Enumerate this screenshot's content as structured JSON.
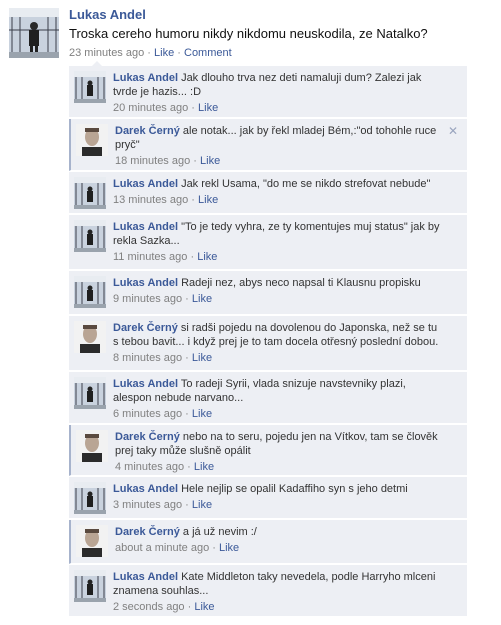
{
  "post": {
    "author": "Lukas Andel",
    "text": "Troska cereho humoru nikdy nikdomu neuskodila, ze Natalko?",
    "time": "23 minutes ago",
    "separator": "·",
    "like": "Like",
    "comment": "Comment"
  },
  "comments": [
    {
      "author": "Lukas Andel",
      "text": "Jak dlouho trva nez deti namaluji dum? Zalezi jak tvrde je hazis... :D",
      "time": "20 minutes ago",
      "like": "Like"
    },
    {
      "author": "Darek Černý",
      "text": "ale notak... jak by řekl mladej Bém,:\"od tohohle ruce pryč\"",
      "time": "18 minutes ago",
      "like": "Like",
      "close": "✕"
    },
    {
      "author": "Lukas Andel",
      "text": "Jak rekl Usama, \"do me se nikdo strefovat nebude\"",
      "time": "13 minutes ago",
      "like": "Like"
    },
    {
      "author": "Lukas Andel",
      "text": "\"To je tedy vyhra, ze ty komentujes muj status\" jak by rekla Sazka...",
      "time": "11 minutes ago",
      "like": "Like"
    },
    {
      "author": "Lukas Andel",
      "text": "Radeji nez, abys neco napsal ti Klausnu propisku",
      "time": "9 minutes ago",
      "like": "Like"
    },
    {
      "author": "Darek Černý",
      "text": "si radši pojedu na dovolenou do Japonska, než se tu s tebou bavit... i když prej je to tam docela otřesný poslední dobou.",
      "time": "8 minutes ago",
      "like": "Like"
    },
    {
      "author": "Lukas Andel",
      "text": "To radeji Syrii, vlada snizuje navstevniky plazi, alespon nebude narvano...",
      "time": "6 minutes ago",
      "like": "Like"
    },
    {
      "author": "Darek Černý",
      "text": "nebo na to seru, pojedu jen na Vítkov, tam se člověk prej taky může slušně opálit",
      "time": "4 minutes ago",
      "like": "Like"
    },
    {
      "author": "Lukas Andel",
      "text": "Hele nejlip se opalil Kadaffiho syn s jeho detmi",
      "time": "3 minutes ago",
      "like": "Like"
    },
    {
      "author": "Darek Černý",
      "text": "a já už nevim :/",
      "time": "about a minute ago",
      "like": "Like"
    },
    {
      "author": "Lukas Andel",
      "text": "Kate Middleton taky nevedela, podle Harryho mlceni znamena souhlas...",
      "time": "2 seconds ago",
      "like": "Like"
    }
  ]
}
